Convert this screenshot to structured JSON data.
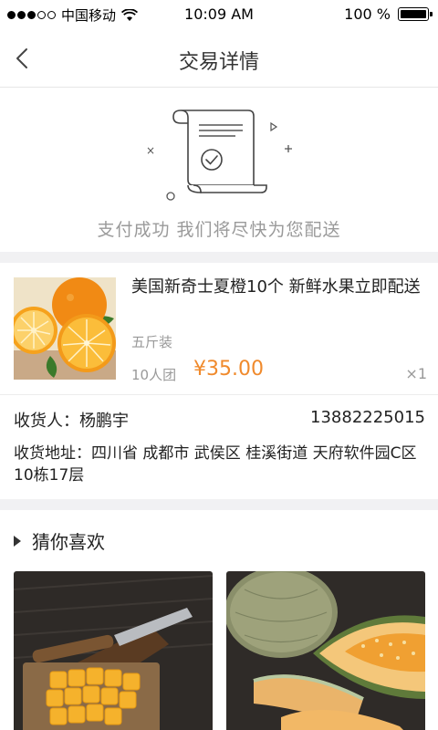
{
  "status_bar": {
    "carrier": "中国移动",
    "time": "10:09 AM",
    "battery": "100 %"
  },
  "nav": {
    "title": "交易详情"
  },
  "success": {
    "message": "支付成功  我们将尽快为您配送"
  },
  "product": {
    "title": "美国新奇士夏橙10个 新鲜水果立即配送",
    "spec": "五斤装",
    "group": "10人团",
    "price": "¥35.00",
    "quantity": "×1"
  },
  "delivery": {
    "receiver": "收货人：杨鹏宇",
    "phone": "13882225015",
    "address": "收货地址：四川省 成都市 武侯区 桂溪街道 天府软件园C区10栋17层"
  },
  "recommend": {
    "title": "猜你喜欢"
  },
  "colors": {
    "accent": "#f08a2c",
    "muted": "#999999",
    "divider": "#f1f1f3"
  }
}
